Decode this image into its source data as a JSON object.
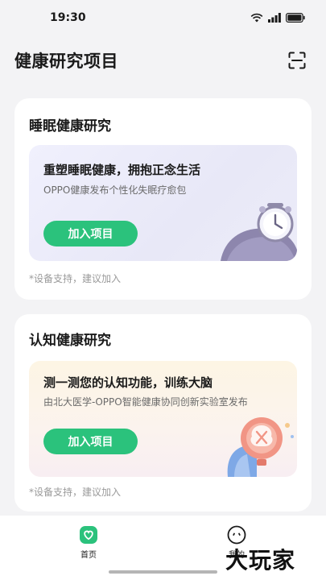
{
  "status_bar": {
    "time": "19:30"
  },
  "header": {
    "title": "健康研究项目"
  },
  "sleep_card": {
    "title": "睡眠健康研究",
    "promo_title": "重塑睡眠健康，拥抱正念生活",
    "promo_subtitle": "OPPO健康发布个性化失眠疗愈包",
    "button": "加入项目",
    "note": "*设备支持，建议加入"
  },
  "cognition_card": {
    "title": "认知健康研究",
    "promo_title": "测一测您的认知功能，训练大脑",
    "promo_subtitle": "由北大医学-OPPO智能健康协同创新实验室发布",
    "button": "加入项目",
    "note": "*设备支持，建议加入"
  },
  "bottom_nav": {
    "items": [
      {
        "label": "首页",
        "icon": "home-heart-icon",
        "active": true
      },
      {
        "label": "我的",
        "icon": "profile-face-icon",
        "active": false
      }
    ]
  },
  "watermark": "大玩家",
  "colors": {
    "accent": "#2bc27c",
    "background": "#f3f3f5"
  }
}
